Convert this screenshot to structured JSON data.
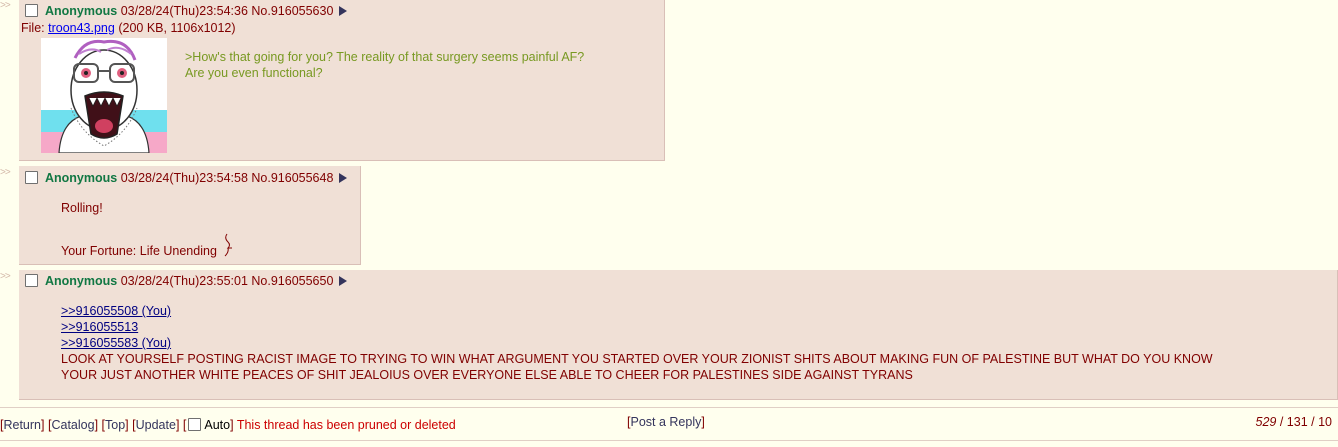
{
  "side_marker": ">>",
  "posts": [
    {
      "name": "Anonymous",
      "date": "03/28/24(Thu)23:54:36",
      "number": "No.916055630",
      "file": {
        "label": "File:",
        "filename": "troon43.png",
        "meta": "(200 KB, 1106x1012)"
      },
      "lines": [
        ">How's that going for you? The reality of that surgery seems painful AF?",
        "Are you even functional?"
      ]
    },
    {
      "name": "Anonymous",
      "date": "03/28/24(Thu)23:54:58",
      "number": "No.916055648",
      "lines": [
        "Rolling!",
        "Your Fortune: Life Unending"
      ]
    },
    {
      "name": "Anonymous",
      "date": "03/28/24(Thu)23:55:01",
      "number": "No.916055650",
      "quotelinks": [
        ">>916055508 (You)",
        ">>916055513",
        ">>916055583 (You)"
      ],
      "lines": [
        "LOOK AT YOURSELF POSTING RACIST IMAGE TO TRYING TO WIN WHAT ARGUMENT YOU STARTED OVER YOUR ZIONIST SHITS ABOUT MAKING FUN OF PALESTINE BUT WHAT DO YOU KNOW",
        "YOUR JUST ANOTHER WHITE PEACES OF SHIT JEALOIUS OVER EVERYONE ELSE ABLE TO CHEER FOR PALESTINES SIDE AGAINST TYRANS"
      ]
    }
  ],
  "bottom": {
    "return": "Return",
    "catalog": "Catalog",
    "top": "Top",
    "update": "Update",
    "auto": "Auto",
    "pruned": "This thread has been pruned or deleted",
    "post_reply": "Post a Reply",
    "stats": {
      "replies": "529",
      "images": "131",
      "posters": "10"
    }
  },
  "colors": {
    "background": "#ffffee",
    "post_bg": "#f0e0d6",
    "name": "#117743",
    "quote": "#789922",
    "link": "#34345c"
  }
}
